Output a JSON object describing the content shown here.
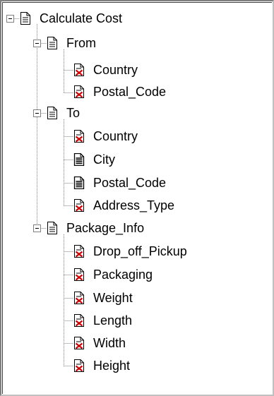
{
  "tree": {
    "root": {
      "label": "Calculate Cost",
      "icon": "document-icon",
      "expanded": true,
      "children": [
        {
          "label": "From",
          "icon": "document-icon",
          "expanded": true,
          "children": [
            {
              "label": "Country",
              "icon": "document-error-icon"
            },
            {
              "label": "Postal_Code",
              "icon": "document-error-icon"
            }
          ]
        },
        {
          "label": "To",
          "icon": "document-icon",
          "expanded": true,
          "children": [
            {
              "label": "Country",
              "icon": "document-error-icon"
            },
            {
              "label": "City",
              "icon": "document-filled-icon"
            },
            {
              "label": "Postal_Code",
              "icon": "document-filled-icon"
            },
            {
              "label": "Address_Type",
              "icon": "document-error-icon"
            }
          ]
        },
        {
          "label": "Package_Info",
          "icon": "document-icon",
          "expanded": true,
          "children": [
            {
              "label": "Drop_off_Pickup",
              "icon": "document-error-icon"
            },
            {
              "label": "Packaging",
              "icon": "document-error-icon"
            },
            {
              "label": "Weight",
              "icon": "document-error-icon"
            },
            {
              "label": "Length",
              "icon": "document-error-icon"
            },
            {
              "label": "Width",
              "icon": "document-error-icon"
            },
            {
              "label": "Height",
              "icon": "document-error-icon"
            }
          ]
        }
      ]
    }
  },
  "colors": {
    "error_mark": "#cc0000",
    "connector": "#808080",
    "icon_outline": "#000000"
  }
}
